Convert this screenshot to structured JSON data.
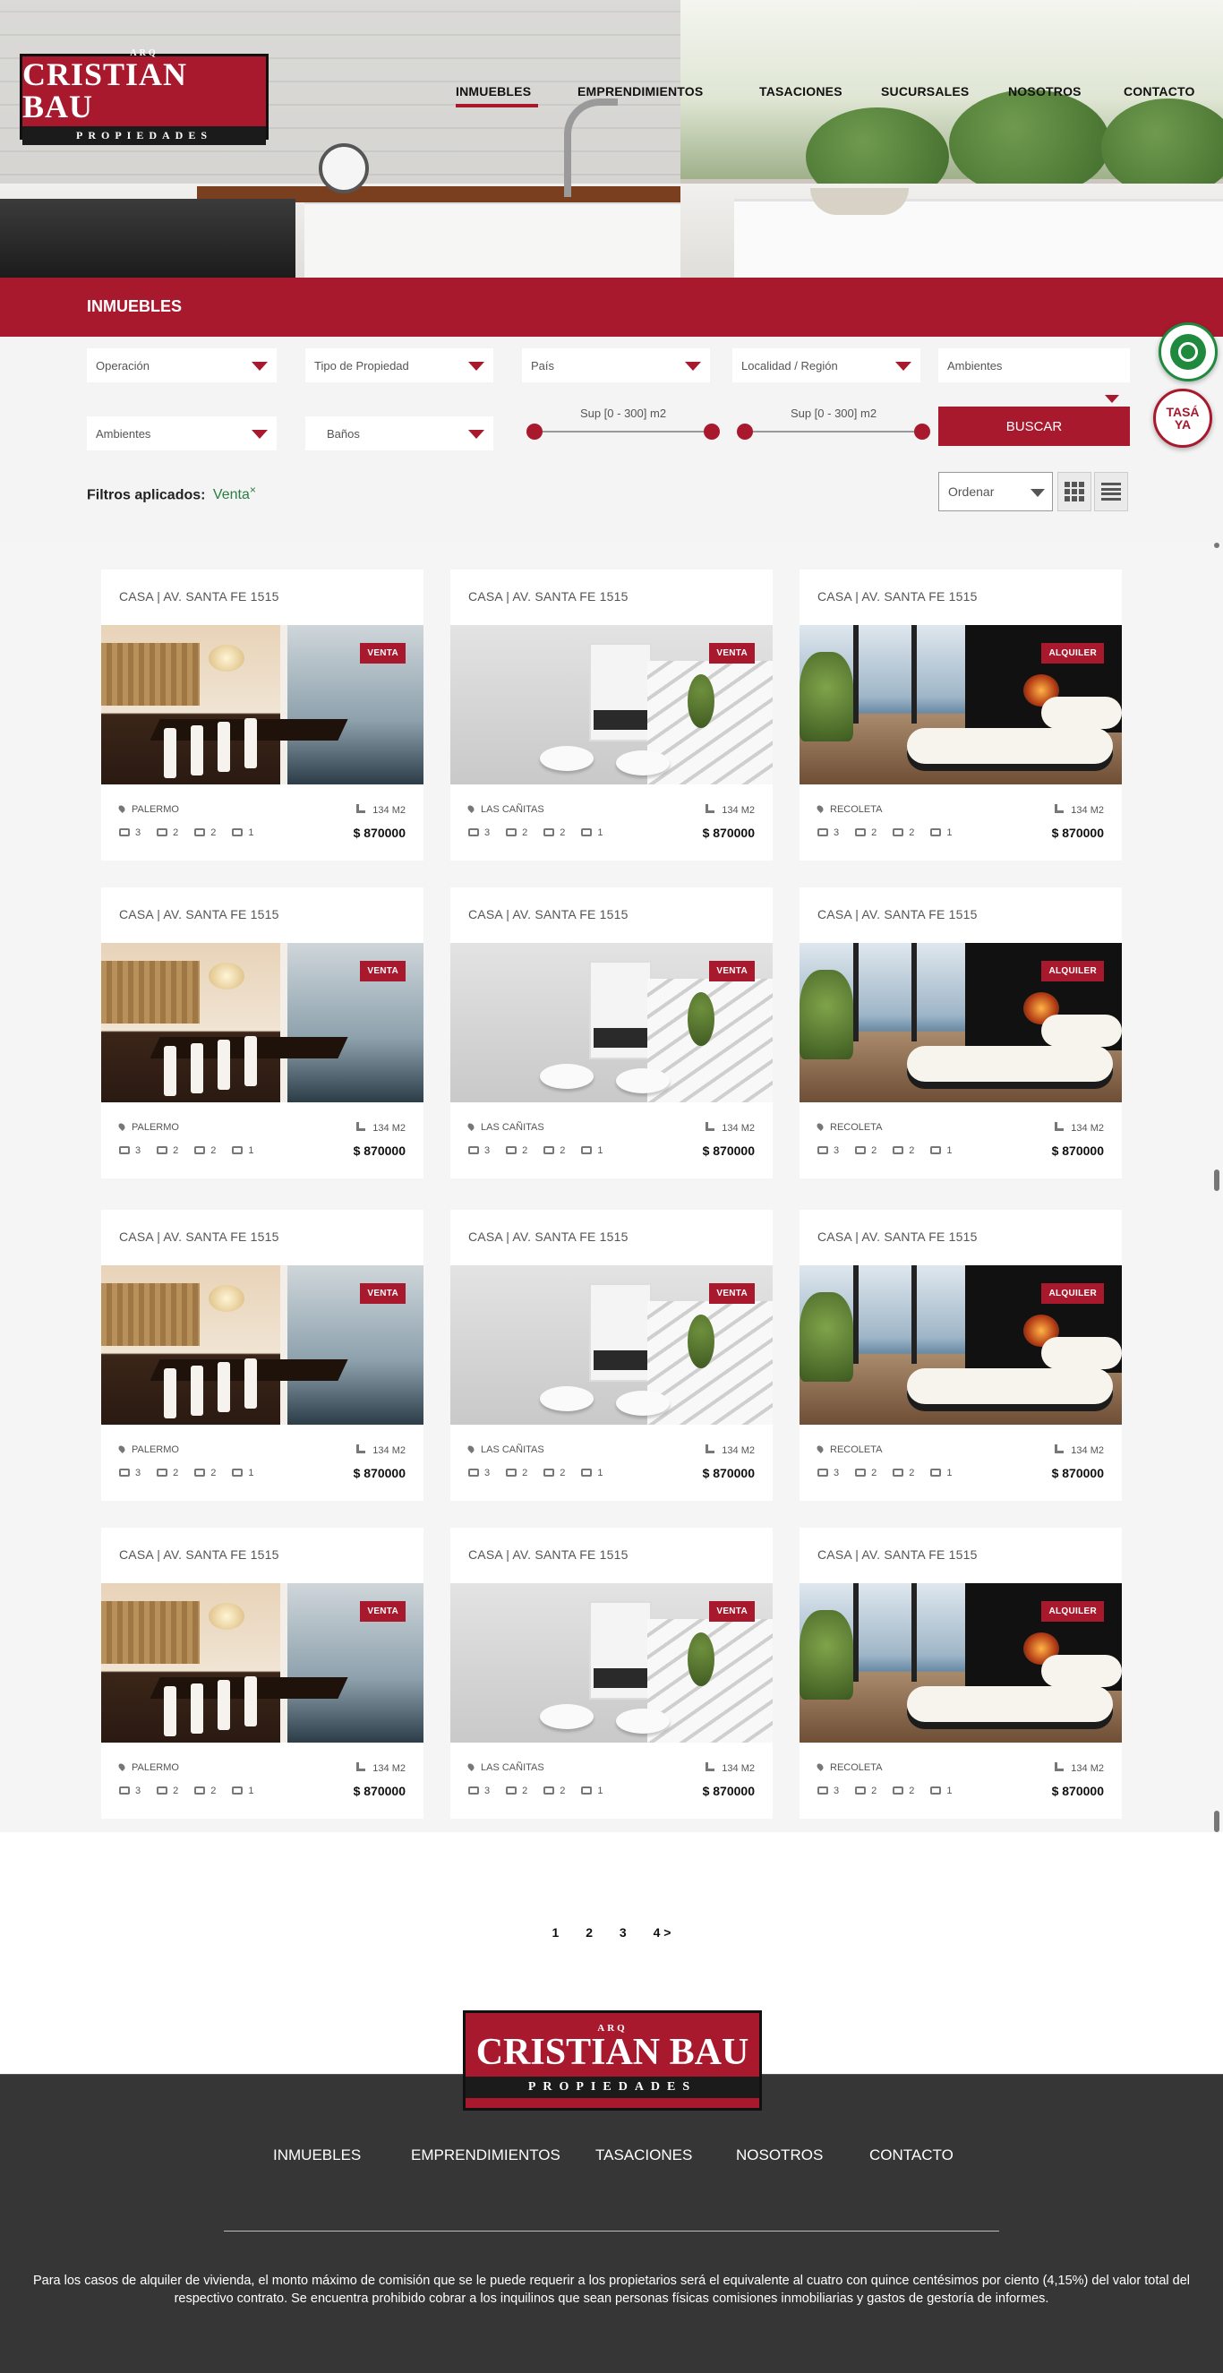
{
  "brand": {
    "arq": "ARQ",
    "name": "CRISTIAN BAU",
    "sub": "PROPIEDADES"
  },
  "nav": [
    {
      "label": "INMUEBLES",
      "active": true
    },
    {
      "label": "EMPRENDIMIENTOS"
    },
    {
      "label": "TASACIONES"
    },
    {
      "label": "SUCURSALES"
    },
    {
      "label": "NOSOTROS"
    },
    {
      "label": "CONTACTO"
    }
  ],
  "section_title": "INMUEBLES",
  "filters": {
    "operacion": "Operación",
    "tipo": "Tipo de Propiedad",
    "pais": "País",
    "localidad": "Localidad / Región",
    "ambientes_top": "Ambientes",
    "ambientes": "Ambientes",
    "banos": "Baños",
    "sup_1": "Sup [0 - 300] m2",
    "sup_2": "Sup [0 - 300] m2",
    "buscar": "BUSCAR"
  },
  "applied": {
    "label": "Filtros aplicados:",
    "value": "Venta",
    "remove": "×"
  },
  "order": {
    "label": "Ordenar"
  },
  "floating": {
    "whatsapp_icon": "whatsapp-icon",
    "tasa": "TASÁ YA"
  },
  "colors": {
    "brand_red": "#a8192e",
    "footer_bg": "#363636",
    "filter_green": "#2b7d40"
  },
  "listings": [
    {
      "title": "CASA | AV. SANTA FE 1515",
      "badge": "VENTA",
      "location": "PALERMO",
      "area": "134 M2",
      "f1": "3",
      "f2": "2",
      "f3": "2",
      "f4": "1",
      "price": "$ 870000",
      "scene": "dining"
    },
    {
      "title": "CASA | AV. SANTA FE 1515",
      "badge": "VENTA",
      "location": "LAS CAÑITAS",
      "area": "134 M2",
      "f1": "3",
      "f2": "2",
      "f3": "2",
      "f4": "1",
      "price": "$ 870000",
      "scene": "white"
    },
    {
      "title": "CASA | AV. SANTA FE 1515",
      "badge": "ALQUILER",
      "location": "RECOLETA",
      "area": "134 M2",
      "f1": "3",
      "f2": "2",
      "f3": "2",
      "f4": "1",
      "price": "$ 870000",
      "scene": "sea"
    },
    {
      "title": "CASA | AV. SANTA FE 1515",
      "badge": "VENTA",
      "location": "PALERMO",
      "area": "134 M2",
      "f1": "3",
      "f2": "2",
      "f3": "2",
      "f4": "1",
      "price": "$ 870000",
      "scene": "dining"
    },
    {
      "title": "CASA | AV. SANTA FE 1515",
      "badge": "VENTA",
      "location": "LAS CAÑITAS",
      "area": "134 M2",
      "f1": "3",
      "f2": "2",
      "f3": "2",
      "f4": "1",
      "price": "$ 870000",
      "scene": "white"
    },
    {
      "title": "CASA | AV. SANTA FE 1515",
      "badge": "ALQUILER",
      "location": "RECOLETA",
      "area": "134 M2",
      "f1": "3",
      "f2": "2",
      "f3": "2",
      "f4": "1",
      "price": "$ 870000",
      "scene": "sea"
    },
    {
      "title": "CASA | AV. SANTA FE 1515",
      "badge": "VENTA",
      "location": "PALERMO",
      "area": "134 M2",
      "f1": "3",
      "f2": "2",
      "f3": "2",
      "f4": "1",
      "price": "$ 870000",
      "scene": "dining"
    },
    {
      "title": "CASA | AV. SANTA FE 1515",
      "badge": "VENTA",
      "location": "LAS CAÑITAS",
      "area": "134 M2",
      "f1": "3",
      "f2": "2",
      "f3": "2",
      "f4": "1",
      "price": "$ 870000",
      "scene": "white"
    },
    {
      "title": "CASA | AV. SANTA FE 1515",
      "badge": "ALQUILER",
      "location": "RECOLETA",
      "area": "134 M2",
      "f1": "3",
      "f2": "2",
      "f3": "2",
      "f4": "1",
      "price": "$ 870000",
      "scene": "sea"
    },
    {
      "title": "CASA | AV. SANTA FE 1515",
      "badge": "VENTA",
      "location": "PALERMO",
      "area": "134 M2",
      "f1": "3",
      "f2": "2",
      "f3": "2",
      "f4": "1",
      "price": "$ 870000",
      "scene": "dining"
    },
    {
      "title": "CASA | AV. SANTA FE 1515",
      "badge": "VENTA",
      "location": "LAS CAÑITAS",
      "area": "134 M2",
      "f1": "3",
      "f2": "2",
      "f3": "2",
      "f4": "1",
      "price": "$ 870000",
      "scene": "white"
    },
    {
      "title": "CASA | AV. SANTA FE 1515",
      "badge": "ALQUILER",
      "location": "RECOLETA",
      "area": "134 M2",
      "f1": "3",
      "f2": "2",
      "f3": "2",
      "f4": "1",
      "price": "$ 870000",
      "scene": "sea"
    }
  ],
  "pagination": [
    "1",
    "2",
    "3",
    "4 >"
  ],
  "footer": {
    "nav": [
      "INMUEBLES",
      "EMPRENDIMIENTOS",
      "TASACIONES",
      "NOSOTROS",
      "CONTACTO"
    ],
    "legal": "Para los casos de alquiler de vivienda, el monto máximo de comisión que se le puede requerir a los propietarios será el equivalente al cuatro con quince centésimos por ciento (4,15%) del valor total del respectivo contrato. Se encuentra prohibido cobrar a los inquilinos que sean personas físicas comisiones inmobiliarias y gastos de gestoría de informes."
  }
}
